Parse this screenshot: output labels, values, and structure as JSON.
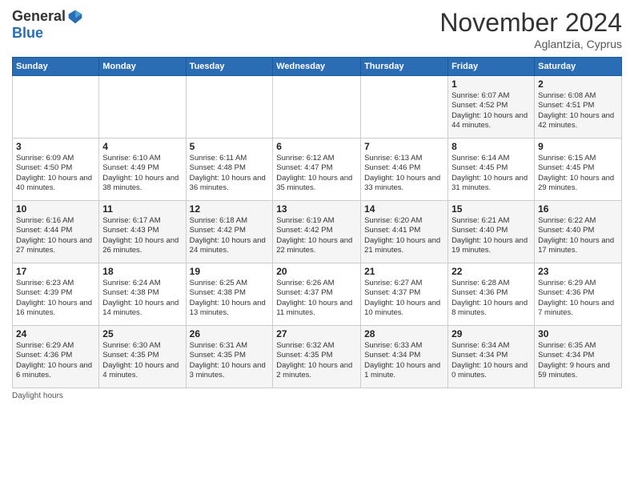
{
  "logo": {
    "general": "General",
    "blue": "Blue"
  },
  "header": {
    "month": "November 2024",
    "location": "Aglantzia, Cyprus"
  },
  "weekdays": [
    "Sunday",
    "Monday",
    "Tuesday",
    "Wednesday",
    "Thursday",
    "Friday",
    "Saturday"
  ],
  "weeks": [
    [
      {
        "day": "",
        "info": ""
      },
      {
        "day": "",
        "info": ""
      },
      {
        "day": "",
        "info": ""
      },
      {
        "day": "",
        "info": ""
      },
      {
        "day": "",
        "info": ""
      },
      {
        "day": "1",
        "info": "Sunrise: 6:07 AM\nSunset: 4:52 PM\nDaylight: 10 hours and 44 minutes."
      },
      {
        "day": "2",
        "info": "Sunrise: 6:08 AM\nSunset: 4:51 PM\nDaylight: 10 hours and 42 minutes."
      }
    ],
    [
      {
        "day": "3",
        "info": "Sunrise: 6:09 AM\nSunset: 4:50 PM\nDaylight: 10 hours and 40 minutes."
      },
      {
        "day": "4",
        "info": "Sunrise: 6:10 AM\nSunset: 4:49 PM\nDaylight: 10 hours and 38 minutes."
      },
      {
        "day": "5",
        "info": "Sunrise: 6:11 AM\nSunset: 4:48 PM\nDaylight: 10 hours and 36 minutes."
      },
      {
        "day": "6",
        "info": "Sunrise: 6:12 AM\nSunset: 4:47 PM\nDaylight: 10 hours and 35 minutes."
      },
      {
        "day": "7",
        "info": "Sunrise: 6:13 AM\nSunset: 4:46 PM\nDaylight: 10 hours and 33 minutes."
      },
      {
        "day": "8",
        "info": "Sunrise: 6:14 AM\nSunset: 4:45 PM\nDaylight: 10 hours and 31 minutes."
      },
      {
        "day": "9",
        "info": "Sunrise: 6:15 AM\nSunset: 4:45 PM\nDaylight: 10 hours and 29 minutes."
      }
    ],
    [
      {
        "day": "10",
        "info": "Sunrise: 6:16 AM\nSunset: 4:44 PM\nDaylight: 10 hours and 27 minutes."
      },
      {
        "day": "11",
        "info": "Sunrise: 6:17 AM\nSunset: 4:43 PM\nDaylight: 10 hours and 26 minutes."
      },
      {
        "day": "12",
        "info": "Sunrise: 6:18 AM\nSunset: 4:42 PM\nDaylight: 10 hours and 24 minutes."
      },
      {
        "day": "13",
        "info": "Sunrise: 6:19 AM\nSunset: 4:42 PM\nDaylight: 10 hours and 22 minutes."
      },
      {
        "day": "14",
        "info": "Sunrise: 6:20 AM\nSunset: 4:41 PM\nDaylight: 10 hours and 21 minutes."
      },
      {
        "day": "15",
        "info": "Sunrise: 6:21 AM\nSunset: 4:40 PM\nDaylight: 10 hours and 19 minutes."
      },
      {
        "day": "16",
        "info": "Sunrise: 6:22 AM\nSunset: 4:40 PM\nDaylight: 10 hours and 17 minutes."
      }
    ],
    [
      {
        "day": "17",
        "info": "Sunrise: 6:23 AM\nSunset: 4:39 PM\nDaylight: 10 hours and 16 minutes."
      },
      {
        "day": "18",
        "info": "Sunrise: 6:24 AM\nSunset: 4:38 PM\nDaylight: 10 hours and 14 minutes."
      },
      {
        "day": "19",
        "info": "Sunrise: 6:25 AM\nSunset: 4:38 PM\nDaylight: 10 hours and 13 minutes."
      },
      {
        "day": "20",
        "info": "Sunrise: 6:26 AM\nSunset: 4:37 PM\nDaylight: 10 hours and 11 minutes."
      },
      {
        "day": "21",
        "info": "Sunrise: 6:27 AM\nSunset: 4:37 PM\nDaylight: 10 hours and 10 minutes."
      },
      {
        "day": "22",
        "info": "Sunrise: 6:28 AM\nSunset: 4:36 PM\nDaylight: 10 hours and 8 minutes."
      },
      {
        "day": "23",
        "info": "Sunrise: 6:29 AM\nSunset: 4:36 PM\nDaylight: 10 hours and 7 minutes."
      }
    ],
    [
      {
        "day": "24",
        "info": "Sunrise: 6:29 AM\nSunset: 4:36 PM\nDaylight: 10 hours and 6 minutes."
      },
      {
        "day": "25",
        "info": "Sunrise: 6:30 AM\nSunset: 4:35 PM\nDaylight: 10 hours and 4 minutes."
      },
      {
        "day": "26",
        "info": "Sunrise: 6:31 AM\nSunset: 4:35 PM\nDaylight: 10 hours and 3 minutes."
      },
      {
        "day": "27",
        "info": "Sunrise: 6:32 AM\nSunset: 4:35 PM\nDaylight: 10 hours and 2 minutes."
      },
      {
        "day": "28",
        "info": "Sunrise: 6:33 AM\nSunset: 4:34 PM\nDaylight: 10 hours and 1 minute."
      },
      {
        "day": "29",
        "info": "Sunrise: 6:34 AM\nSunset: 4:34 PM\nDaylight: 10 hours and 0 minutes."
      },
      {
        "day": "30",
        "info": "Sunrise: 6:35 AM\nSunset: 4:34 PM\nDaylight: 9 hours and 59 minutes."
      }
    ]
  ],
  "footer": {
    "daylight_label": "Daylight hours"
  }
}
